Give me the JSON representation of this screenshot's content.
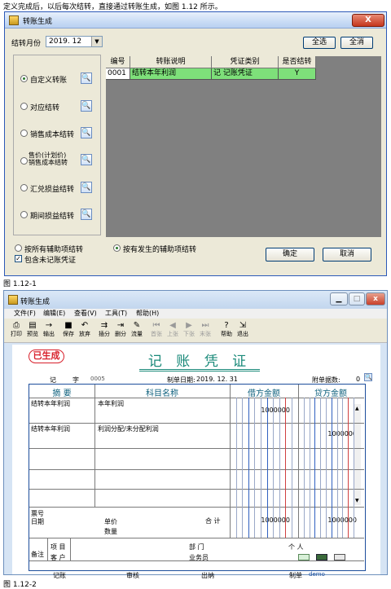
{
  "caption_top": "定义完成后，以后每次结转，直接通过转账生成，如图 1.12 所示。",
  "dialog1": {
    "title": "转账生成",
    "close_label": "X",
    "month_label": "结转月份",
    "month_value": "2019. 12",
    "select_all": "全选",
    "deselect_all": "全消",
    "options": [
      {
        "label": "自定义转账",
        "selected": true
      },
      {
        "label": "对应结转",
        "selected": false
      },
      {
        "label": "销售成本结转",
        "selected": false
      },
      {
        "label": "售价（计划价）销售成本结转",
        "line1": "售价(计划价)",
        "line2": "销售成本结转",
        "selected": false
      },
      {
        "label": "汇兑损益结转",
        "selected": false
      },
      {
        "label": "期间损益结转",
        "selected": false
      }
    ],
    "grid_headers": [
      "编号",
      "转账说明",
      "凭证类别",
      "是否结转"
    ],
    "grid_rows": [
      {
        "code": "0001",
        "desc": "结转本年利润",
        "type": "记 记账凭证",
        "flag": "Y"
      }
    ],
    "radio_all_aux": "按所有辅助项结转",
    "radio_occurred_aux": "按有发生的辅助项结转",
    "include_unposted": "包含未记账凭证",
    "ok": "确定",
    "cancel": "取消"
  },
  "caption1": "图 1.12-1",
  "window2": {
    "title": "转账生成",
    "menus": [
      "文件(F)",
      "编辑(E)",
      "查看(V)",
      "工具(T)",
      "帮助(H)"
    ],
    "toolbar": [
      {
        "label": "打印",
        "icon": "printer-icon",
        "glyph": "⎙",
        "enabled": true
      },
      {
        "label": "预览",
        "icon": "preview-icon",
        "glyph": "▤",
        "enabled": true
      },
      {
        "label": "输出",
        "icon": "export-icon",
        "glyph": "→",
        "enabled": true
      },
      {
        "label": "保存",
        "icon": "save-icon",
        "glyph": "■",
        "enabled": true
      },
      {
        "label": "放弃",
        "icon": "undo-icon",
        "glyph": "↶",
        "enabled": true
      },
      {
        "label": "插分",
        "icon": "insert-row-icon",
        "glyph": "⇉",
        "enabled": true
      },
      {
        "label": "删分",
        "icon": "delete-row-icon",
        "glyph": "⇥",
        "enabled": true
      },
      {
        "label": "流量",
        "icon": "flow-icon",
        "glyph": "✎",
        "enabled": true
      },
      {
        "label": "首张",
        "icon": "first-icon",
        "glyph": "⏮",
        "enabled": false
      },
      {
        "label": "上张",
        "icon": "prev-icon",
        "glyph": "◀",
        "enabled": false
      },
      {
        "label": "下张",
        "icon": "next-icon",
        "glyph": "▶",
        "enabled": false
      },
      {
        "label": "末张",
        "icon": "last-icon",
        "glyph": "⏭",
        "enabled": false
      },
      {
        "label": "帮助",
        "icon": "help-icon",
        "glyph": "?",
        "enabled": true
      },
      {
        "label": "退出",
        "icon": "exit-icon",
        "glyph": "⇲",
        "enabled": true
      }
    ],
    "status_stamp": "已生成",
    "voucher_title": "记 账 凭 证",
    "voucher_word_label": "记",
    "voucher_zi": "字",
    "voucher_no": "0005",
    "date_label": "制单日期:",
    "date_value": "2019. 12. 31",
    "attach_label": "附单据数:",
    "attach_value": "0",
    "headers": {
      "summary": "摘 要",
      "account": "科目名称",
      "debit": "借方金额",
      "credit": "贷方金额"
    },
    "rows": [
      {
        "summary": "结转本年利润",
        "account": "本年利润",
        "debit": "1000000",
        "credit": ""
      },
      {
        "summary": "结转本年利润",
        "account": "利润分配/未分配利润",
        "debit": "",
        "credit": "1000000"
      }
    ],
    "footer": {
      "ticket_no": "票号",
      "date": "日期",
      "unit_price": "单价",
      "quantity": "数量",
      "total_label": "合 计",
      "total_debit": "1000000",
      "total_credit": "1000000",
      "remarks": "备注",
      "project": "项 目",
      "customer": "客 户",
      "department": "部 门",
      "salesperson": "业务员",
      "person": "个 人"
    },
    "sign": {
      "posting": "记账",
      "audit": "审核",
      "cashier": "出纳",
      "maker": "制单",
      "maker_name": "demo"
    }
  },
  "caption2": "图 1.12-2",
  "colors": {
    "grid_selected": "#7ee07a",
    "voucher_title": "#1a8a7a",
    "stamp": "#d8202b",
    "table_border": "#1d4e9c"
  }
}
